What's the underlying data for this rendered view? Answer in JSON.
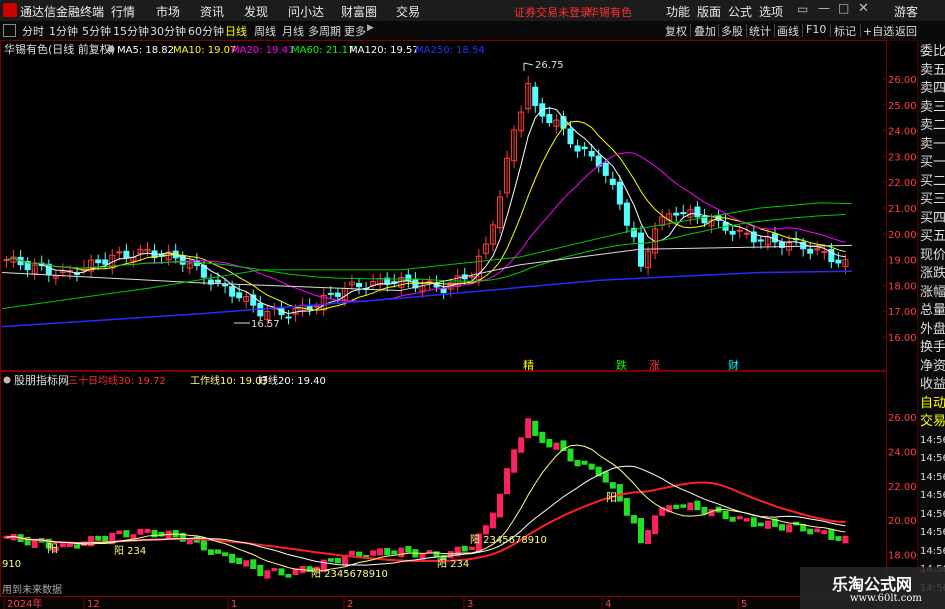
{
  "menubar": {
    "app_title": "通达信金融终端",
    "items": [
      "行情",
      "市场",
      "资讯",
      "发现",
      "问小达",
      "财富圈",
      "交易"
    ],
    "status_text": "证券交易未登录",
    "stock_name": "华锡有色",
    "right_items": [
      "功能",
      "版面",
      "公式",
      "选项"
    ],
    "guest": "游客"
  },
  "toolbar": {
    "periods": [
      "分时",
      "1分钟",
      "5分钟",
      "15分钟",
      "30分钟",
      "60分钟",
      "日线",
      "周线",
      "月线",
      "多周期",
      "更多"
    ],
    "active_period": "日线",
    "right_items": [
      "复权",
      "叠加",
      "多股",
      "统计",
      "画线",
      "F10",
      "标记",
      "+自选",
      "返回"
    ]
  },
  "main_chart": {
    "title": "华锡有色(日线 前复权)",
    "ma_legend": [
      {
        "label": "MA5: 18.82",
        "color": "#ffffff"
      },
      {
        "label": "MA10: 19.07",
        "color": "#ffff00"
      },
      {
        "label": "MA20: 19.41",
        "color": "#ff00ff"
      },
      {
        "label": "MA60: 21.17",
        "color": "#00ff00"
      },
      {
        "label": "MA120: 19.57",
        "color": "#ffffff"
      },
      {
        "label": "MA250: 18.54",
        "color": "#3030ff"
      }
    ],
    "y_ticks": [
      "26.00",
      "25.00",
      "24.00",
      "23.00",
      "22.00",
      "21.00",
      "20.00",
      "19.00",
      "18.00",
      "17.00",
      "16.00"
    ],
    "high_label": "26.75",
    "low_label": "16.57",
    "markers": [
      {
        "text": "精",
        "color": "#ffff00"
      },
      {
        "text": "跌",
        "color": "#00ff00"
      },
      {
        "text": "涨",
        "color": "#ff4040"
      },
      {
        "text": "财",
        "color": "#00ffff"
      }
    ]
  },
  "sub_chart": {
    "title": "股朋指标网",
    "legend": [
      {
        "label": "三十日均线30: 19.72",
        "color": "#ff3030"
      },
      {
        "label": "工作线10: 19.03",
        "color": "#ffff80"
      },
      {
        "label": "好线20: 19.40",
        "color": "#ffffff"
      }
    ],
    "y_ticks": [
      "26.00",
      "24.00",
      "22.00",
      "20.00",
      "18.00"
    ],
    "annotations": [
      {
        "text": "910"
      },
      {
        "text": "阳"
      },
      {
        "text": "阳 234"
      },
      {
        "text": "阳 2345678910"
      },
      {
        "text": "阳 234"
      },
      {
        "text": "阳 2345678910"
      },
      {
        "text": "阳"
      }
    ],
    "future_note": "用到未来数据"
  },
  "x_axis": {
    "labels": [
      "2024年",
      "12",
      "1",
      "2",
      "3",
      "4",
      "5"
    ]
  },
  "side_panel": {
    "items": [
      "委比",
      "卖五",
      "卖四",
      "卖三",
      "卖二",
      "卖一",
      "买一",
      "买二",
      "买三",
      "买四",
      "买五",
      "现价",
      "涨跌",
      "涨幅",
      "总量",
      "外盘",
      "换手",
      "净资",
      "收益",
      "自动",
      "交易",
      "14:56",
      "14:56",
      "14:56",
      "14:56",
      "14:56",
      "14:56",
      "14:56",
      "14:56",
      "14:56"
    ]
  },
  "watermark": {
    "title": "乐淘公式网",
    "url": "www.60lt.com"
  }
}
